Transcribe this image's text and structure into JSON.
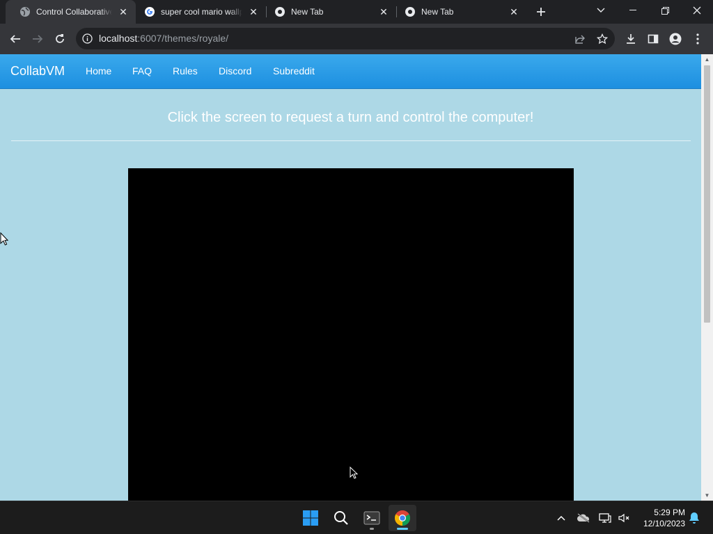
{
  "browser": {
    "tabs": [
      {
        "title": "Control Collaborative Vi",
        "active": true,
        "favicon": "globe-icon"
      },
      {
        "title": "super cool mario wallpaper",
        "active": false,
        "favicon": "google-icon"
      },
      {
        "title": "New Tab",
        "active": false,
        "favicon": "chrome-icon"
      },
      {
        "title": "New Tab",
        "active": false,
        "favicon": "chrome-icon"
      }
    ],
    "address": {
      "host": "localhost",
      "rest": ":6007/themes/royale/"
    }
  },
  "page": {
    "navbar": {
      "brand": "CollabVM",
      "links": [
        "Home",
        "FAQ",
        "Rules",
        "Discord",
        "Subreddit"
      ]
    },
    "headline": "Click the screen to request a turn and control the computer!",
    "vm_screen_color": "#000000"
  },
  "taskbar": {
    "time": "5:29 PM",
    "date": "12/10/2023",
    "apps": [
      "start-icon",
      "search-icon",
      "terminal-icon",
      "chrome-icon"
    ]
  },
  "colors": {
    "page_bg": "#add8e6",
    "navbar_top": "#3aa9ec",
    "navbar_bottom": "#1d8fe0",
    "chrome_dark": "#202124",
    "chrome_toolbar": "#35363a"
  }
}
